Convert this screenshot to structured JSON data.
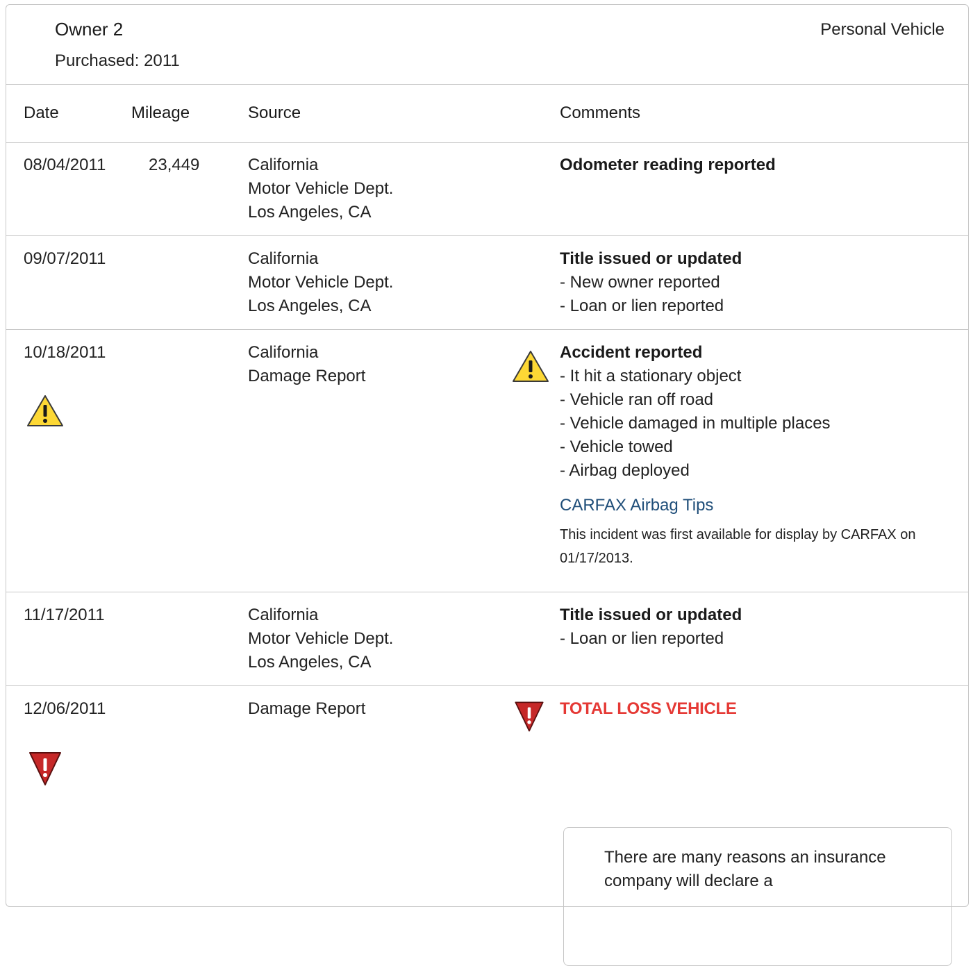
{
  "owner": {
    "title": "Owner 2",
    "purchased": "Purchased: 2011",
    "vehicle_type": "Personal Vehicle"
  },
  "columns": [
    "Date",
    "Mileage",
    "Source",
    "Comments"
  ],
  "rows": [
    {
      "date": "08/04/2011",
      "mileage": "23,449",
      "source": [
        "California",
        "Motor Vehicle Dept.",
        "Los Angeles, CA"
      ],
      "headline": "Odometer reading reported",
      "details": []
    },
    {
      "date": "09/07/2011",
      "mileage": "",
      "source": [
        "California",
        "Motor Vehicle Dept.",
        "Los Angeles, CA"
      ],
      "headline": "Title issued or updated",
      "details": [
        "- New owner reported",
        "- Loan or lien reported"
      ]
    },
    {
      "date": "10/18/2011",
      "mileage": "",
      "source": [
        "California",
        "Damage Report"
      ],
      "headline": "Accident reported",
      "details": [
        "- It hit a stationary object",
        "- Vehicle ran off road",
        "- Vehicle damaged in multiple places",
        "- Vehicle towed",
        "- Airbag deployed"
      ],
      "link": "CARFAX Airbag Tips",
      "note": "This incident was first available for display by CARFAX on 01/17/2013.",
      "alert_icon": "warning-triangle-icon"
    },
    {
      "date": "11/17/2011",
      "mileage": "",
      "source": [
        "California",
        "Motor Vehicle Dept.",
        "Los Angeles, CA"
      ],
      "headline": "Title issued or updated",
      "details": [
        "- Loan or lien reported"
      ]
    },
    {
      "date": "12/06/2011",
      "mileage": "",
      "source": [
        "Damage Report"
      ],
      "headline": "TOTAL LOSS VEHICLE",
      "details": [],
      "alert_icon": "total-loss-icon"
    }
  ],
  "info_box": {
    "text": "There are many reasons an insurance company will declare a"
  },
  "colors": {
    "border": "#c7c7c7",
    "warning_yellow": "#fdd835",
    "alert_red": "#e53935",
    "link_blue": "#1f4e79"
  }
}
